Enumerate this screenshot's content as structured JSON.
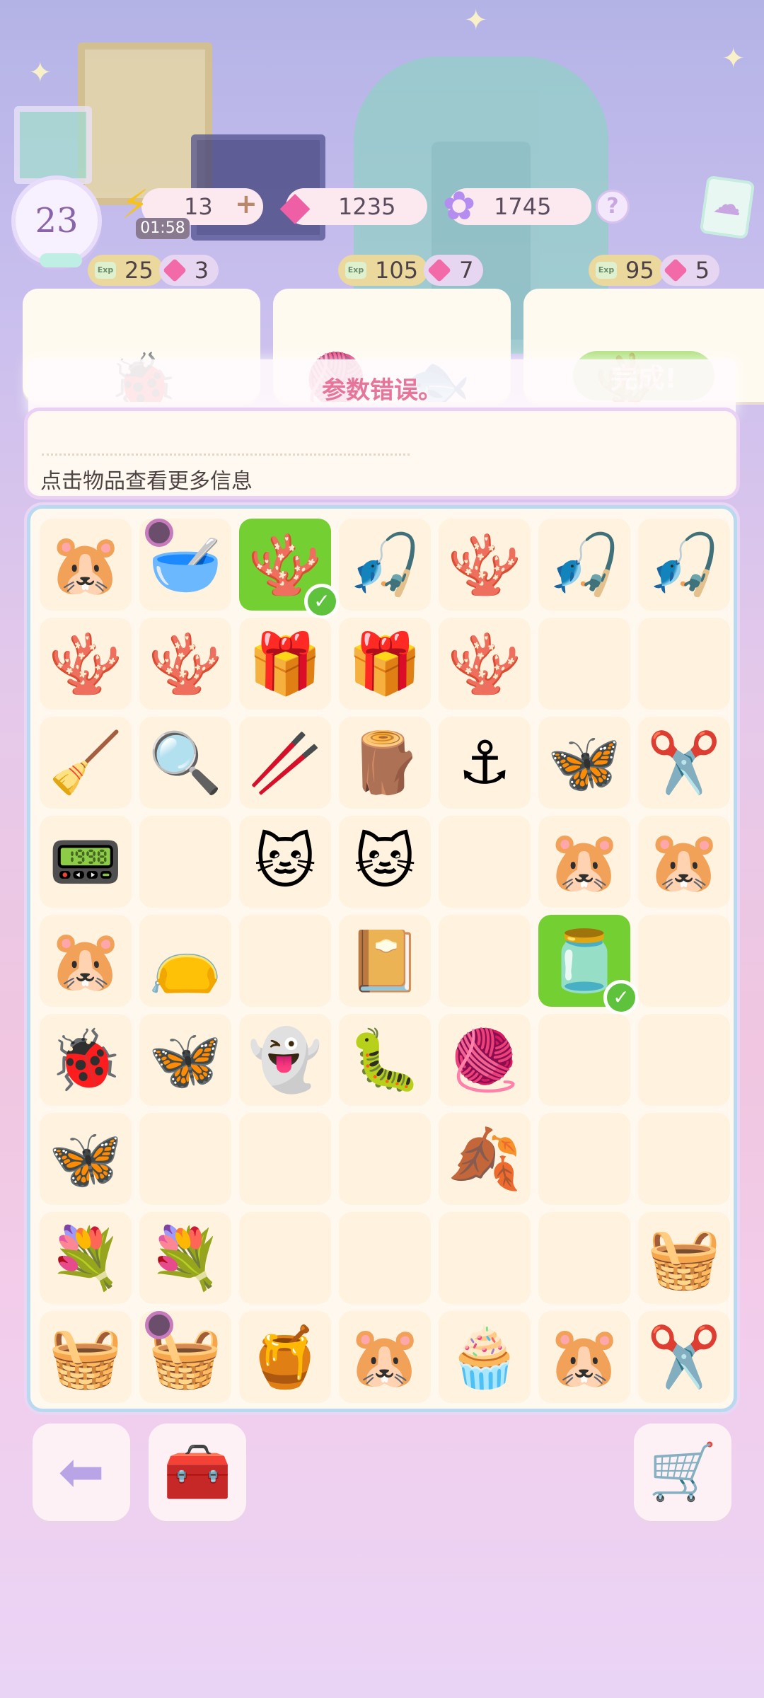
{
  "top_bar": {
    "level": "23",
    "energy": {
      "value": "13",
      "timer": "01:58",
      "plus": "+"
    },
    "gems": {
      "value": "1235"
    },
    "stars": {
      "value": "1745"
    },
    "help": "?"
  },
  "orders": [
    {
      "exp": "25",
      "gems": "3",
      "items": [
        "🐞"
      ]
    },
    {
      "exp": "105",
      "gems": "7",
      "items": [
        "🧶",
        "🐟"
      ]
    },
    {
      "exp": "95",
      "gems": "5",
      "items": [
        "🪸"
      ],
      "complete": true
    }
  ],
  "done_button": "完成!",
  "toast": "参数错误。",
  "info_panel": {
    "hint": "点击物品查看更多信息"
  },
  "board": {
    "cells": [
      {
        "icon": "🐹",
        "name": "hamster-sleeping-item"
      },
      {
        "icon": "🥣",
        "name": "bowl-item",
        "locked": true
      },
      {
        "icon": "🪸",
        "name": "coral-reef-item",
        "selected": true
      },
      {
        "icon": "🎣",
        "name": "fishing-rod-item"
      },
      {
        "icon": "🪸",
        "name": "small-coral-item"
      },
      {
        "icon": "🎣",
        "name": "fishing-rod-item"
      },
      {
        "icon": "🎣",
        "name": "fishing-rod-item"
      },
      {
        "icon": "🪸",
        "name": "coral-item"
      },
      {
        "icon": "🪸",
        "name": "coral-item"
      },
      {
        "icon": "🎁",
        "name": "gift-box-item"
      },
      {
        "icon": "🎁",
        "name": "gift-box-item"
      },
      {
        "icon": "🪸",
        "name": "coral-reef-item"
      },
      {
        "icon": "",
        "name": "empty-cell"
      },
      {
        "icon": "",
        "name": "empty-cell"
      },
      {
        "icon": "🧹",
        "name": "brush-item"
      },
      {
        "icon": "🔍",
        "name": "magnifier-item"
      },
      {
        "icon": "🥢",
        "name": "tweezers-item"
      },
      {
        "icon": "🪵",
        "name": "wood-stand-item"
      },
      {
        "icon": "⚓",
        "name": "anchor-item"
      },
      {
        "icon": "🦋",
        "name": "butterfly-item"
      },
      {
        "icon": "✂️",
        "name": "scissors-item"
      },
      {
        "icon": "📟",
        "name": "tamagotchi-item"
      },
      {
        "icon": "",
        "name": "empty-cell"
      },
      {
        "icon": "🐱",
        "name": "cat-item"
      },
      {
        "icon": "🐱",
        "name": "cat-item"
      },
      {
        "icon": "",
        "name": "empty-cell"
      },
      {
        "icon": "🐹",
        "name": "hamster-baby-item"
      },
      {
        "icon": "🐹",
        "name": "hamster-baby-item"
      },
      {
        "icon": "🐹",
        "name": "hamster-reading-item"
      },
      {
        "icon": "👝",
        "name": "firefly-pouch-item"
      },
      {
        "icon": "",
        "name": "empty-cell"
      },
      {
        "icon": "📔",
        "name": "notebook-item"
      },
      {
        "icon": "",
        "name": "empty-cell"
      },
      {
        "icon": "🫙",
        "name": "firefly-jar-item",
        "selected": true
      },
      {
        "icon": "",
        "name": "empty-cell"
      },
      {
        "icon": "🐞",
        "name": "ladybug-item"
      },
      {
        "icon": "🦋",
        "name": "butterfly-item"
      },
      {
        "icon": "👻",
        "name": "jellyfish-item"
      },
      {
        "icon": "🐛",
        "name": "cocoon-item"
      },
      {
        "icon": "🧶",
        "name": "silk-item"
      },
      {
        "icon": "",
        "name": "empty-cell"
      },
      {
        "icon": "",
        "name": "empty-cell"
      },
      {
        "icon": "🦋",
        "name": "butterfly-item"
      },
      {
        "icon": "",
        "name": "empty-cell"
      },
      {
        "icon": "",
        "name": "empty-cell"
      },
      {
        "icon": "",
        "name": "empty-cell"
      },
      {
        "icon": "🍂",
        "name": "leaf-item"
      },
      {
        "icon": "",
        "name": "empty-cell"
      },
      {
        "icon": "",
        "name": "empty-cell"
      },
      {
        "icon": "💐",
        "name": "bouquet-item"
      },
      {
        "icon": "💐",
        "name": "bouquet-item"
      },
      {
        "icon": "",
        "name": "empty-cell"
      },
      {
        "icon": "",
        "name": "empty-cell"
      },
      {
        "icon": "",
        "name": "empty-cell"
      },
      {
        "icon": "",
        "name": "empty-cell"
      },
      {
        "icon": "🧺",
        "name": "basket-item"
      },
      {
        "icon": "🧺",
        "name": "flower-basket-item"
      },
      {
        "icon": "🧺",
        "name": "flower-basket-item",
        "locked": true
      },
      {
        "icon": "🍯",
        "name": "honey-jar-item"
      },
      {
        "icon": "🐹",
        "name": "hamster-reading-item"
      },
      {
        "icon": "🧁",
        "name": "mixer-item"
      },
      {
        "icon": "🐹",
        "name": "hamster-sleeping-item"
      },
      {
        "icon": "✂️",
        "name": "scissors-item"
      }
    ]
  },
  "bottom": {
    "back_icon": "⬅",
    "toolbox_icon": "🧰",
    "shop_icon": "🛒"
  }
}
